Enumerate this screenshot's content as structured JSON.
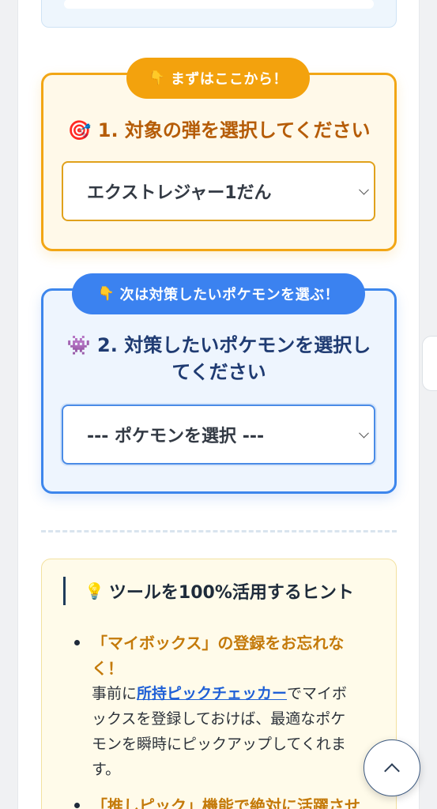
{
  "step1": {
    "badge_emoji": "👇",
    "badge_label": "まずはここから！",
    "title_emoji": "🎯",
    "title": "1. 対象の弾を選択してください",
    "select_value": "エクストレジャー1だん"
  },
  "step2": {
    "badge_emoji": "👇",
    "badge_label": "次は対策したいポケモンを選ぶ！",
    "title_emoji": "👾",
    "title_line1": "2. 対策したいポケモンを選択し",
    "title_line2": "てください",
    "select_value": "--- ポケモンを選択 ---"
  },
  "hints": {
    "heading_emoji": "💡",
    "heading": "ツールを100%活用するヒント",
    "items": [
      {
        "strong_line1": "「マイボックス」の登録をお忘れな",
        "strong_line2": "く！",
        "text_prefix": "事前に",
        "link": "所持ピックチェッカー",
        "text_line1_suffix": "でマイボ",
        "text_line2": "ックスを登録しておけば、最適なポケ",
        "text_line3": "モンを瞬時にピックアップしてくれま",
        "text_line4": "す。"
      },
      {
        "strong_line1": "「推しピック」機能で絶対に活躍させ"
      }
    ]
  }
}
